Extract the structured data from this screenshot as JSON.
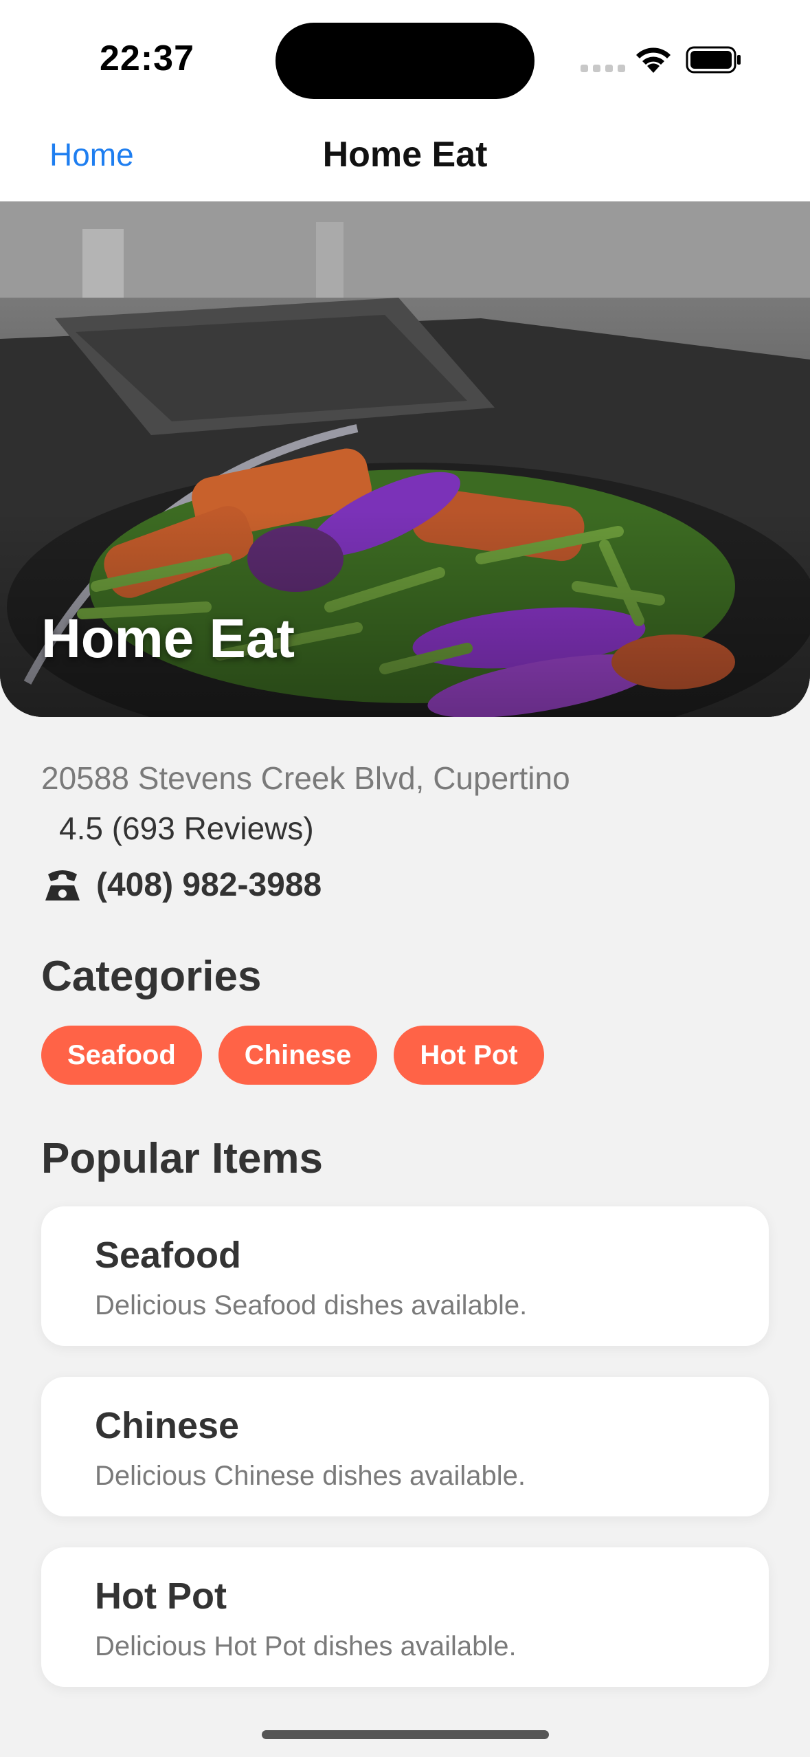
{
  "status_bar": {
    "time": "22:37"
  },
  "nav": {
    "back_label": "Home",
    "title": "Home Eat"
  },
  "hero": {
    "title": "Home Eat"
  },
  "info": {
    "address": "20588 Stevens Creek Blvd, Cupertino",
    "rating": "4.5 (693 Reviews)",
    "phone": "(408) 982-3988"
  },
  "categories": {
    "heading": "Categories",
    "items": [
      "Seafood",
      "Chinese",
      "Hot Pot"
    ]
  },
  "popular": {
    "heading": "Popular Items",
    "items": [
      {
        "title": "Seafood",
        "description": "Delicious Seafood dishes available."
      },
      {
        "title": "Chinese",
        "description": "Delicious Chinese dishes available."
      },
      {
        "title": "Hot Pot",
        "description": "Delicious Hot Pot dishes available."
      }
    ]
  },
  "colors": {
    "accent": "#ff6347",
    "link": "#1e7ef0",
    "background": "#f2f2f2"
  }
}
